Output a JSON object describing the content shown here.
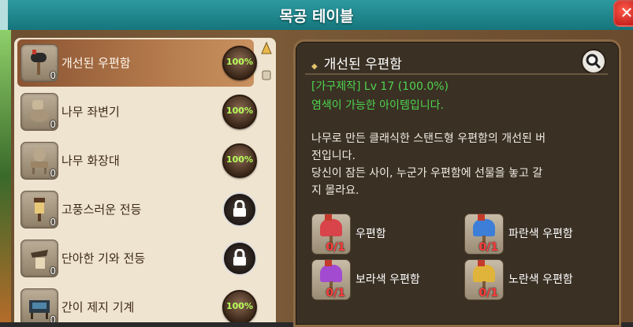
{
  "window": {
    "title": "목공 테이블",
    "close_label": "✕"
  },
  "recipe_list": [
    {
      "name": "개선된 우편함",
      "qty": "0",
      "progress": "100%",
      "locked": false,
      "selected": true
    },
    {
      "name": "나무 좌변기",
      "qty": "0",
      "progress": "100%",
      "locked": false,
      "selected": false
    },
    {
      "name": "나무 화장대",
      "qty": "0",
      "progress": "100%",
      "locked": false,
      "selected": false
    },
    {
      "name": "고풍스러운 전등",
      "qty": "0",
      "progress": "",
      "locked": true,
      "selected": false
    },
    {
      "name": "단아한 기와 전등",
      "qty": "0",
      "progress": "",
      "locked": true,
      "selected": false
    },
    {
      "name": "간이 제지 기계",
      "qty": "0",
      "progress": "100%",
      "locked": false,
      "selected": false
    }
  ],
  "detail": {
    "title": "개선된 우편함",
    "skill_line": "[가구제작] Lv 17 (100.0%)",
    "dye_line": "염색이 가능한 아이템입니다.",
    "description_lines": [
      "나무로 만든 클래식한 스탠드형 우편함의 개선된 버",
      "전입니다.",
      "당신이 잠든 사이, 누군가 우편함에 선물을 놓고 갈",
      "지 몰라요."
    ],
    "materials": [
      {
        "name": "우편함",
        "count": "0/1",
        "color": "#d8444a"
      },
      {
        "name": "파란색 우편함",
        "count": "0/1",
        "color": "#3d7ed8"
      },
      {
        "name": "보라색 우편함",
        "count": "0/1",
        "color": "#a24ad0"
      },
      {
        "name": "노란색 우편함",
        "count": "0/1",
        "color": "#e0b43a"
      }
    ]
  },
  "icons": {
    "close": "close-icon",
    "search": "magnifier-icon",
    "lock": "lock-icon",
    "scroll_up": "triangle-up-icon"
  }
}
